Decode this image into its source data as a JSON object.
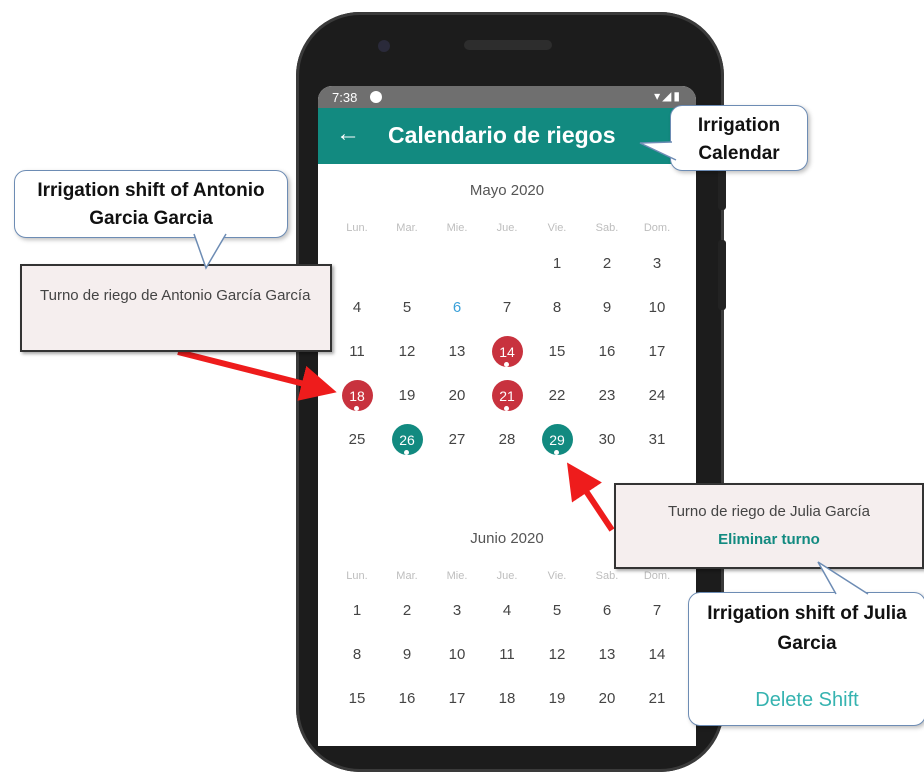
{
  "status_bar": {
    "time": "7:38",
    "icons": "▾◢▮"
  },
  "app_bar": {
    "back_icon": "←",
    "title": "Calendario de riegos"
  },
  "months": [
    {
      "title": "Mayo 2020",
      "weekdays": [
        "Lun.",
        "Mar.",
        "Mie.",
        "Jue.",
        "Vie.",
        "Sab.",
        "Dom."
      ],
      "days": [
        "1",
        "2",
        "3",
        "4",
        "5",
        "6",
        "7",
        "8",
        "9",
        "10",
        "11",
        "12",
        "13",
        "14",
        "15",
        "16",
        "17",
        "18",
        "19",
        "20",
        "21",
        "22",
        "23",
        "24",
        "25",
        "26",
        "27",
        "28",
        "29",
        "30",
        "31"
      ]
    },
    {
      "title": "Junio 2020",
      "weekdays": [
        "Lun.",
        "Mar.",
        "Mie.",
        "Jue.",
        "Vie.",
        "Sab.",
        "Dom."
      ],
      "days": [
        "1",
        "2",
        "3",
        "4",
        "5",
        "6",
        "7",
        "8",
        "9",
        "10",
        "11",
        "12",
        "13",
        "14",
        "15",
        "16",
        "17",
        "18",
        "19",
        "20",
        "21"
      ]
    }
  ],
  "today": "6",
  "colors": {
    "brand": "#128a80",
    "shift_antonio": "#c8323e",
    "shift_julia": "#128a80",
    "today": "#3aa0d8",
    "arrow": "#ee1c1c"
  },
  "shifts": {
    "antonio_days": [
      "14",
      "18",
      "21"
    ],
    "julia_days": [
      "26",
      "29"
    ]
  },
  "popup_antonio": {
    "text": "Turno de riego de Antonio García García"
  },
  "popup_julia": {
    "text": "Turno de riego de Julia García",
    "action": "Eliminar turno"
  },
  "annotations": {
    "irrigation_calendar": "Irrigation Calendar",
    "antonio_shift": "Irrigation shift of Antonio Garcia Garcia",
    "julia_shift": "Irrigation shift of Julia Garcia",
    "delete_shift": "Delete Shift"
  }
}
